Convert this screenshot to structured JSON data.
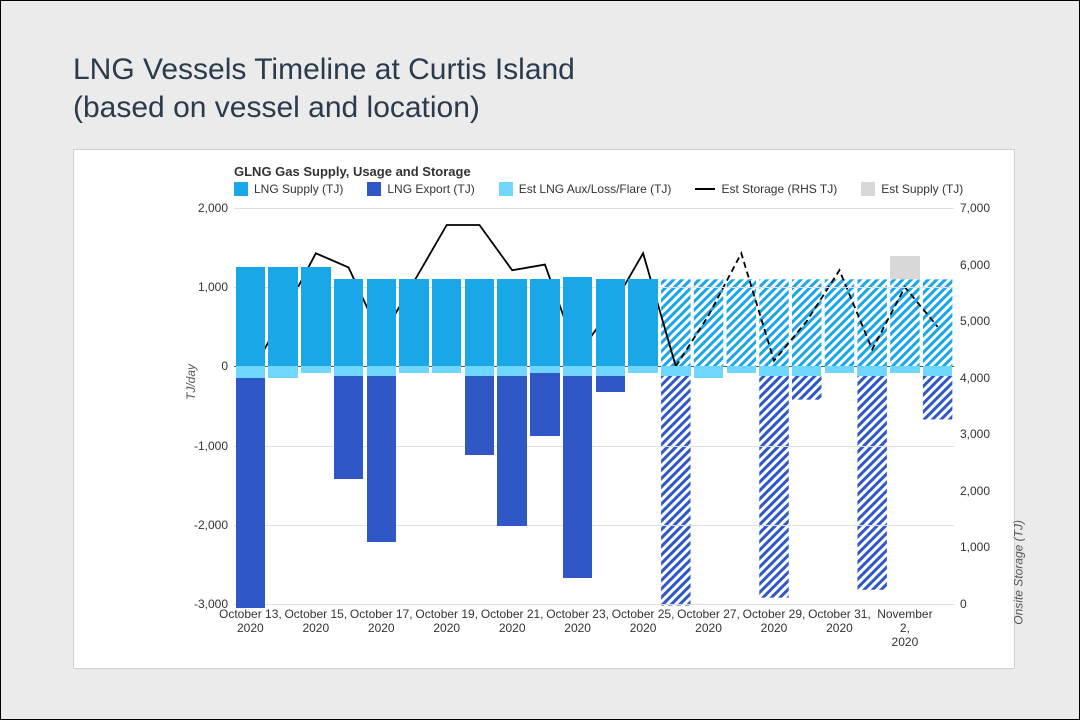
{
  "title_line1": "LNG Vessels Timeline at Curtis Island",
  "title_line2": "(based on vessel and location)",
  "chart_title": "GLNG Gas Supply, Usage and Storage",
  "legend": {
    "supply": "LNG Supply (TJ)",
    "export": "LNG Export (TJ)",
    "aux": "Est LNG Aux/Loss/Flare (TJ)",
    "storage": "Est Storage (RHS TJ)",
    "est_supply": "Est Supply (TJ)"
  },
  "colors": {
    "supply": "#1aa7e8",
    "export": "#2f58c6",
    "aux": "#6fd6ff",
    "est_supply": "#d8d8d8",
    "storage_line": "#000"
  },
  "y_left_label": "TJ/day",
  "y_right_label": "Onsite Storage (TJ)",
  "y_left_ticks": [
    "2,000",
    "1,000",
    "0",
    "-1,000",
    "-2,000",
    "-3,000"
  ],
  "y_right_ticks": [
    "7,000",
    "6,000",
    "5,000",
    "4,000",
    "3,000",
    "2,000",
    "1,000",
    "0"
  ],
  "x_ticks": [
    "October 13, 2020",
    "October 15, 2020",
    "October 17, 2020",
    "October 19, 2020",
    "October 21, 2020",
    "October 23, 2020",
    "October 25, 2020",
    "October 27, 2020",
    "October 29, 2020",
    "October 31, 2020",
    "November 2, 2020"
  ],
  "chart_data": {
    "type": "bar",
    "title": "GLNG Gas Supply, Usage and Storage",
    "xlabel": "",
    "ylabel_left": "TJ/day",
    "ylabel_right": "Onsite Storage (TJ)",
    "ylim_left": [
      -3000,
      2000
    ],
    "ylim_right": [
      0,
      7000
    ],
    "categories": [
      "Oct 13",
      "Oct 14",
      "Oct 15",
      "Oct 16",
      "Oct 17",
      "Oct 18",
      "Oct 19",
      "Oct 20",
      "Oct 21",
      "Oct 22",
      "Oct 23",
      "Oct 24",
      "Oct 25",
      "Oct 26",
      "Oct 27",
      "Oct 28",
      "Oct 29",
      "Oct 30",
      "Oct 31",
      "Nov 1",
      "Nov 2",
      "Nov 3"
    ],
    "forecast_from_index": 13,
    "series": [
      {
        "name": "LNG Supply (TJ)",
        "axis": "left",
        "color": "#1aa7e8",
        "values": [
          1250,
          1250,
          1250,
          1100,
          1100,
          1100,
          1100,
          1100,
          1100,
          1100,
          1130,
          1100,
          1100,
          1100,
          1100,
          1100,
          1100,
          1100,
          1100,
          1100,
          1100,
          1100
        ]
      },
      {
        "name": "Est Supply (TJ)",
        "axis": "left",
        "color": "#d8d8d8",
        "values": [
          null,
          null,
          null,
          null,
          null,
          null,
          null,
          null,
          null,
          null,
          null,
          null,
          null,
          null,
          null,
          null,
          null,
          null,
          null,
          null,
          1400,
          1050
        ]
      },
      {
        "name": "LNG Export (TJ)",
        "axis": "left",
        "color": "#2f58c6",
        "values": [
          -2900,
          0,
          0,
          -1300,
          -2100,
          0,
          0,
          -1000,
          -1900,
          -800,
          -2550,
          -200,
          0,
          -2900,
          0,
          0,
          -2800,
          -300,
          0,
          -2700,
          0,
          -550
        ]
      },
      {
        "name": "Est LNG Aux/Loss/Flare (TJ)",
        "axis": "left",
        "color": "#6fd6ff",
        "values": [
          -150,
          -150,
          -80,
          -120,
          -120,
          -80,
          -80,
          -120,
          -120,
          -80,
          -120,
          -120,
          -80,
          -120,
          -150,
          -80,
          -120,
          -120,
          -80,
          -120,
          -80,
          -120
        ]
      },
      {
        "name": "Est Storage (RHS TJ)",
        "axis": "right",
        "type": "line",
        "color": "#000",
        "values": [
          4050,
          5100,
          6200,
          5950,
          4700,
          5700,
          6700,
          6700,
          5900,
          6000,
          4400,
          5200,
          6200,
          4200,
          5100,
          6200,
          4300,
          5000,
          5900,
          4500,
          5600,
          4900
        ]
      }
    ]
  }
}
